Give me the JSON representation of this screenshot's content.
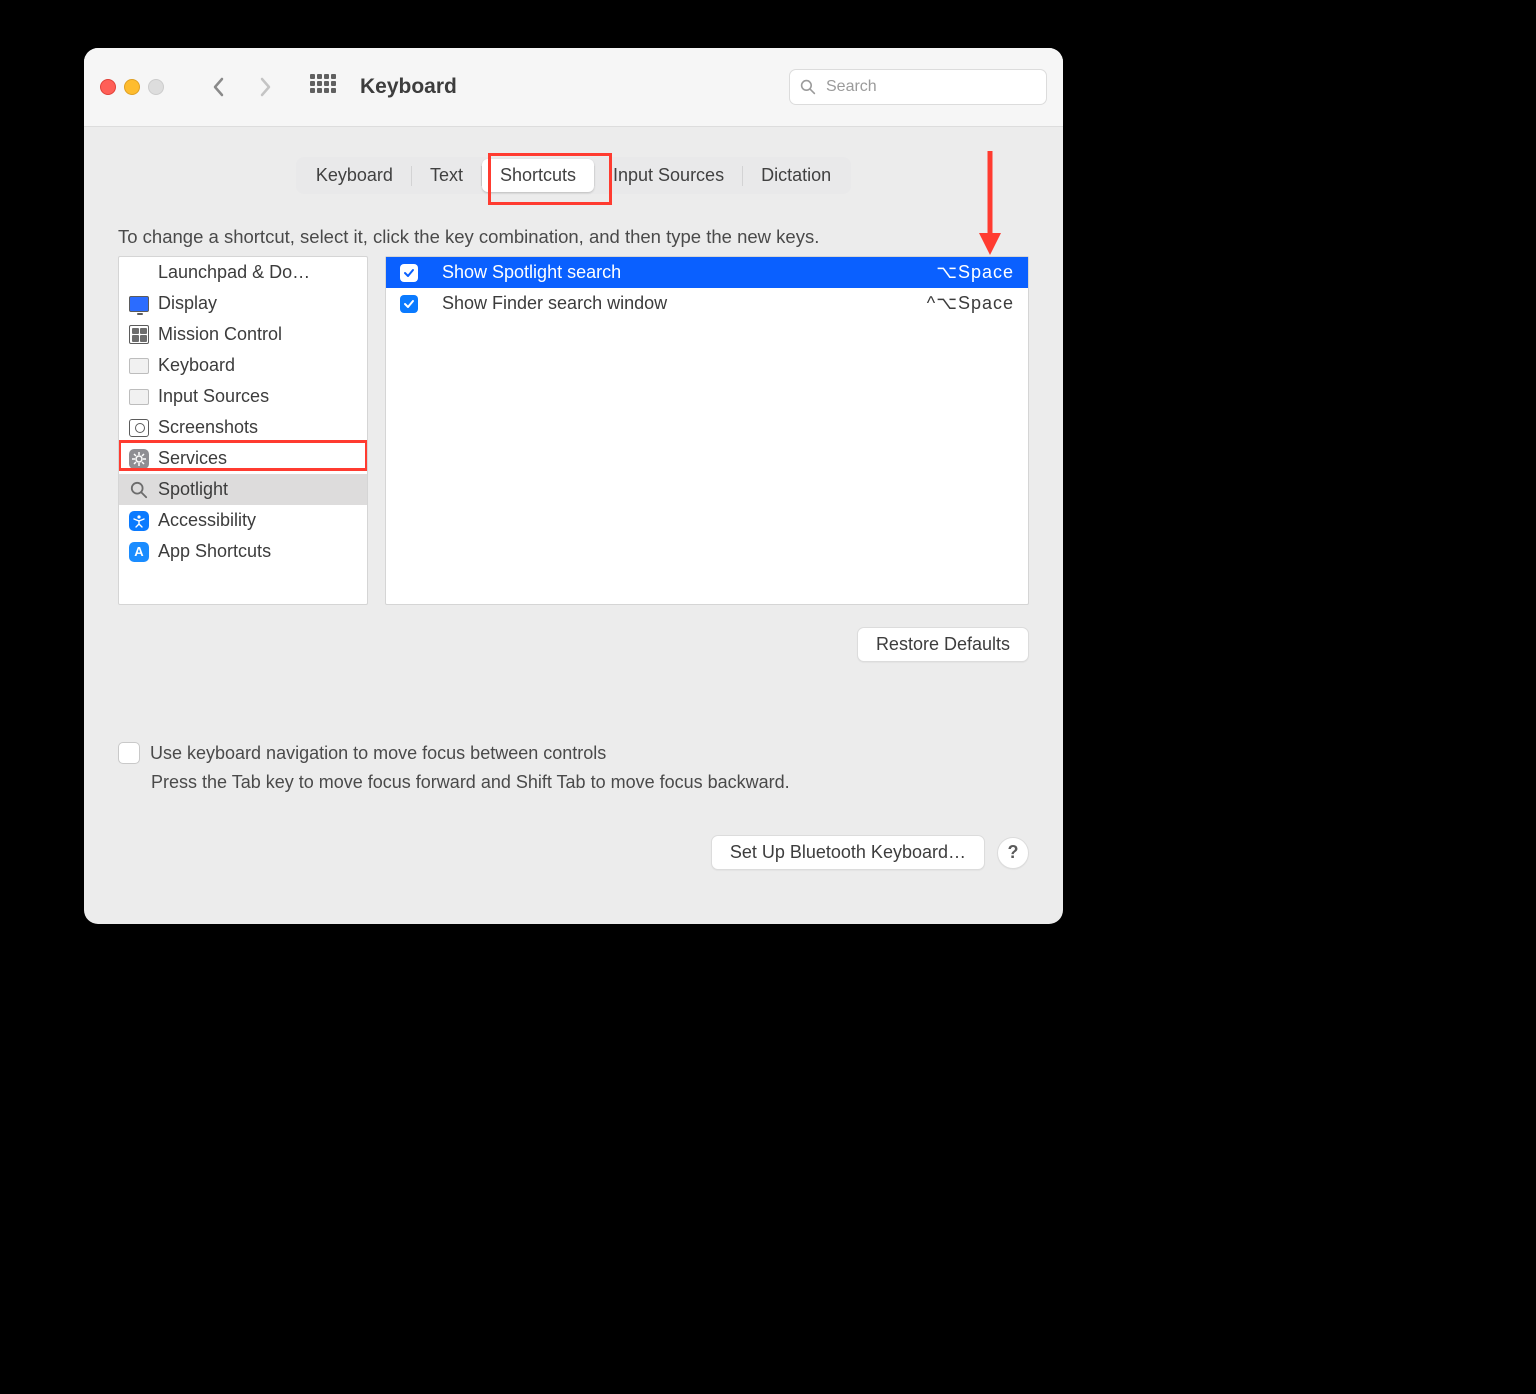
{
  "window": {
    "title": "Keyboard"
  },
  "search": {
    "placeholder": "Search"
  },
  "tabs": [
    {
      "label": "Keyboard"
    },
    {
      "label": "Text"
    },
    {
      "label": "Shortcuts",
      "active": true
    },
    {
      "label": "Input Sources"
    },
    {
      "label": "Dictation"
    }
  ],
  "instructions": "To change a shortcut, select it, click the key combination, and then type the new keys.",
  "categories": [
    {
      "label": "Launchpad & Do…",
      "icon": "launchpad"
    },
    {
      "label": "Display",
      "icon": "display"
    },
    {
      "label": "Mission Control",
      "icon": "mission-control"
    },
    {
      "label": "Keyboard",
      "icon": "keyboard"
    },
    {
      "label": "Input Sources",
      "icon": "input-sources"
    },
    {
      "label": "Screenshots",
      "icon": "screenshots"
    },
    {
      "label": "Services",
      "icon": "services"
    },
    {
      "label": "Spotlight",
      "icon": "spotlight",
      "selected": true
    },
    {
      "label": "Accessibility",
      "icon": "accessibility"
    },
    {
      "label": "App Shortcuts",
      "icon": "app-shortcuts"
    }
  ],
  "shortcuts": [
    {
      "checked": true,
      "label": "Show Spotlight search",
      "keys": "⌥Space",
      "selected": true
    },
    {
      "checked": true,
      "label": "Show Finder search window",
      "keys": "^⌥Space",
      "selected": false
    }
  ],
  "buttons": {
    "restore": "Restore Defaults",
    "bluetooth": "Set Up Bluetooth Keyboard…",
    "help": "?"
  },
  "kbnav": {
    "checked": false,
    "line1": "Use keyboard navigation to move focus between controls",
    "line2": "Press the Tab key to move focus forward and Shift Tab to move focus backward."
  }
}
